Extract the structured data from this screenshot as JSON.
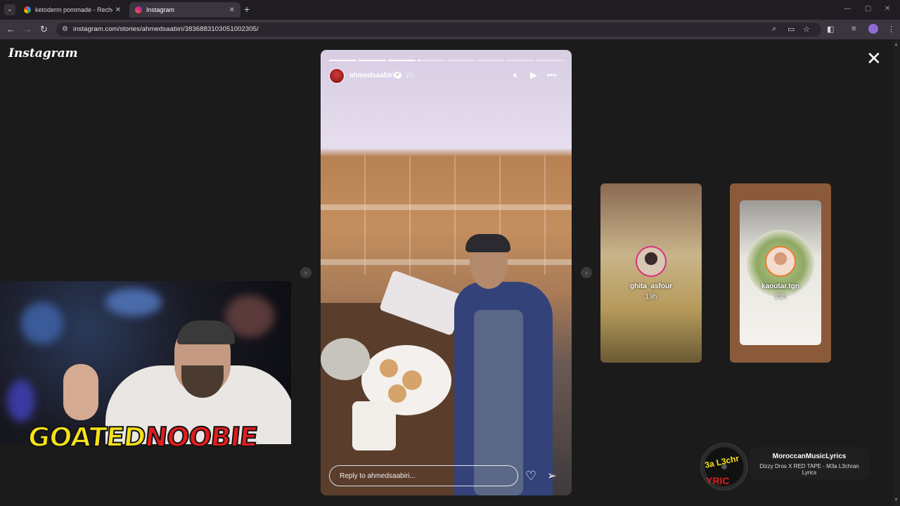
{
  "browser": {
    "tabs": [
      {
        "title": "ketoderm pommade - Recherch",
        "favicon": "google-icon",
        "active": false
      },
      {
        "title": "Instagram",
        "favicon": "instagram-icon",
        "active": true
      }
    ],
    "url": "instagram.com/stories/ahmedsaabiri/3836883103051002305/"
  },
  "page": {
    "logo": "Instagram"
  },
  "story": {
    "username": "ahmedsaabiri",
    "time": "1h",
    "segments": 8,
    "reply_placeholder": "Reply to ahmedsaabiri..."
  },
  "previews": [
    {
      "username": "ghita_asfour",
      "time": "19h"
    },
    {
      "username": "kaoutar.tgn",
      "time": "23h"
    }
  ],
  "overlay": {
    "brand_part1": "GOATED",
    "brand_part2": "NOOBIE"
  },
  "music": {
    "channel": "MoroccanMusicLyrics",
    "track": "Dizzy Dros X RED TAPE - M3a L3chran Lyrics",
    "disc_text_1": "3a L3chr",
    "disc_text_2": "YRIC"
  },
  "colors": {
    "page_bg": "#1b1b1b",
    "chrome_bg": "#3a353f",
    "brand_yellow": "#f5e11a",
    "brand_red": "#e21d1d"
  }
}
